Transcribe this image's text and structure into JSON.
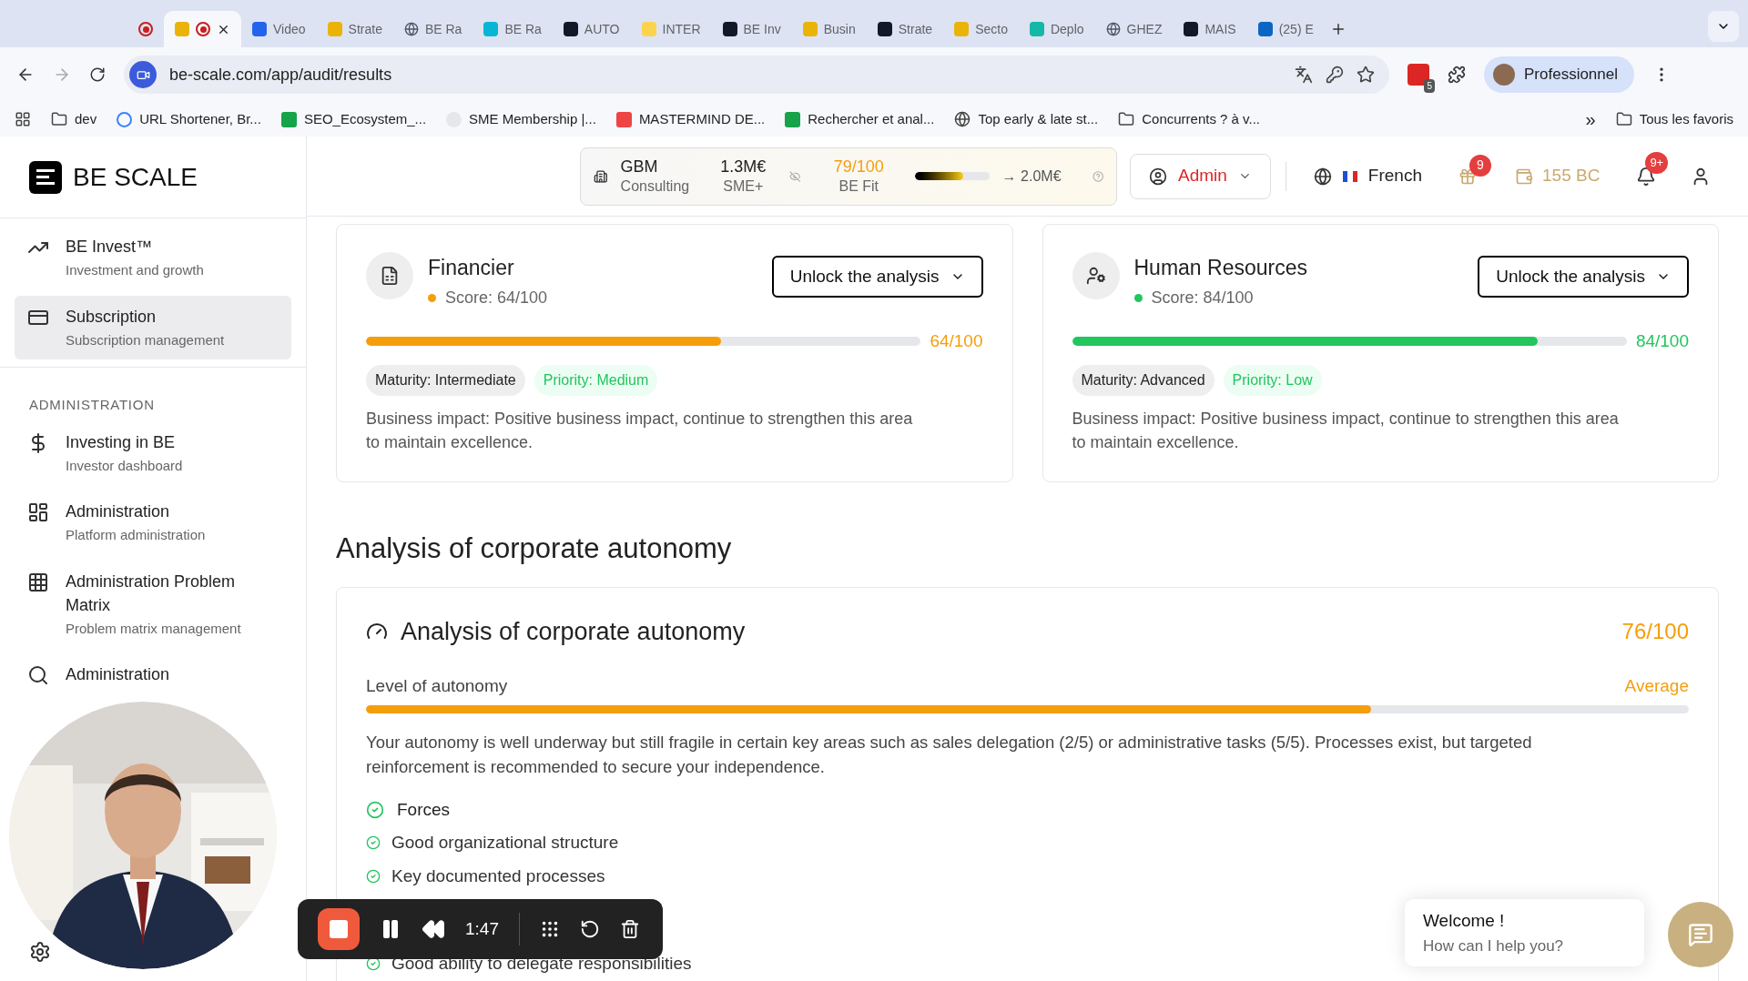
{
  "browser": {
    "tabs": [
      {
        "selected": false
      },
      {
        "selected": true
      },
      {
        "label": "Video",
        "selected": false
      },
      {
        "label": "Strate",
        "selected": false
      },
      {
        "label": "BE Ra",
        "selected": false
      },
      {
        "label": "BE Ra",
        "selected": false
      },
      {
        "label": "AUTO",
        "selected": false
      },
      {
        "label": "INTER",
        "selected": false
      },
      {
        "label": "BE Inv",
        "selected": false
      },
      {
        "label": "Busin",
        "selected": false
      },
      {
        "label": "Strate",
        "selected": false
      },
      {
        "label": "Secto",
        "selected": false
      },
      {
        "label": "Deplo",
        "selected": false
      },
      {
        "label": "GHEZ",
        "selected": false
      },
      {
        "label": "MAIS",
        "selected": false
      },
      {
        "label": "(25) E",
        "selected": false
      }
    ],
    "url": "be-scale.com/app/audit/results",
    "extension_badge": "5",
    "profile": "Professionnel",
    "bookmarks": [
      "dev",
      "URL Shortener, Br...",
      "SEO_Ecosystem_...",
      "SME Membership |...",
      "MASTERMIND DE...",
      "Rechercher et anal...",
      "Top early & late st...",
      "Concurrents ? à v..."
    ],
    "more": "»",
    "all_bookmarks": "Tous les favoris"
  },
  "sidebar": {
    "logo": "BE SCALE",
    "items": [
      {
        "title": "BE Invest™",
        "subtitle": "Investment and growth",
        "selected": false
      },
      {
        "title": "Subscription",
        "subtitle": "Subscription management",
        "selected": true
      }
    ],
    "section": "ADMINISTRATION",
    "admin_items": [
      {
        "title": "Investing in BE",
        "subtitle": "Investor dashboard",
        "selected": false
      },
      {
        "title": "Administration",
        "subtitle": "Platform administration",
        "selected": false
      },
      {
        "title": "Administration Problem Matrix",
        "subtitle": "Problem matrix management",
        "selected": false
      },
      {
        "title": "Administration",
        "selected": false
      }
    ]
  },
  "header": {
    "company": "GBM",
    "sector": "Consulting",
    "revenue": "1.3M€",
    "segment": "SME+",
    "fit_score": "79/100",
    "fit_label": "BE Fit",
    "fit_bar": {
      "level": 0.65
    },
    "target": "→ 2.0M€",
    "role": "Admin",
    "language": "French",
    "gift_badge": "9",
    "credits": "155 BC",
    "notif_badge": "9+"
  },
  "cards": [
    {
      "title": "Financier",
      "score": "Score: 64/100",
      "color": "#f59e0b",
      "button": "Unlock the analysis",
      "level": 0.64,
      "reading": "64/100",
      "maturity": "Maturity: Intermediate",
      "priority": "Priority: Medium",
      "impact": "Business impact: Positive business impact, continue to strengthen this area to maintain excellence."
    },
    {
      "title": "Human Resources",
      "score": "Score: 84/100",
      "color": "#22c55e",
      "button": "Unlock the analysis",
      "level": 0.84,
      "reading": "84/100",
      "maturity": "Maturity: Advanced",
      "priority": "Priority: Low",
      "impact": "Business impact: Positive business impact, continue to strengthen this area to maintain excellence."
    }
  ],
  "autonomy": {
    "section_title": "Analysis of corporate autonomy",
    "title": "Analysis of corporate autonomy",
    "score": "76/100",
    "level_label": "Level of autonomy",
    "level_reading": "Average",
    "level": 0.76,
    "text": "Your autonomy is well underway but still fragile in certain key areas such as sales delegation (2/5) or administrative tasks (5/5). Processes exist, but targeted reinforcement is recommended to secure your independence.",
    "forces_title": "Forces",
    "forces": [
      "Good organizational structure",
      "Key documented processes",
      "Good ability to delegate responsibilities"
    ]
  },
  "recorder": {
    "time": "1:47"
  },
  "chat": {
    "title": "Welcome !",
    "subtitle": "How can I help you?"
  }
}
